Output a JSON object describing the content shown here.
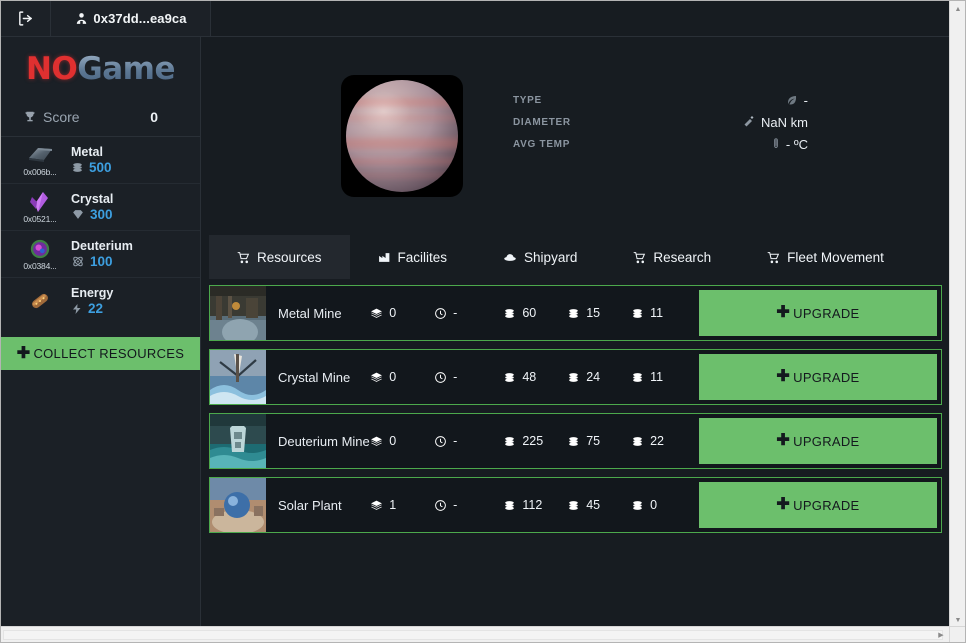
{
  "topbar": {
    "logout_icon": "logout-icon",
    "account_icon": "user-icon",
    "account_label": "0x37dd...ea9ca"
  },
  "sidebar": {
    "logo_primary": "NO",
    "logo_secondary": "Game",
    "score": {
      "icon": "trophy-icon",
      "label": "Score",
      "value": "0"
    },
    "resources": [
      {
        "name": "Metal",
        "address": "0x006b...",
        "amount": "500",
        "icon": "metal-bar-icon",
        "amount_icon": "coins-icon"
      },
      {
        "name": "Crystal",
        "address": "0x0521...",
        "amount": "300",
        "icon": "crystal-icon",
        "amount_icon": "gem-icon"
      },
      {
        "name": "Deuterium",
        "address": "0x0384...",
        "amount": "100",
        "icon": "deuterium-icon",
        "amount_icon": "atom-icon"
      },
      {
        "name": "Energy",
        "address": "",
        "amount": "22",
        "icon": "energy-rod-icon",
        "amount_icon": "bolt-icon"
      }
    ],
    "collect_button": "COLLECT RESOURCES"
  },
  "planet": {
    "image_alt": "planet-thumbnail",
    "stats": [
      {
        "key": "TYPE",
        "icon": "leaf-icon",
        "value": "-"
      },
      {
        "key": "DIAMETER",
        "icon": "ruler-icon",
        "value": "NaN km"
      },
      {
        "key": "AVG TEMP",
        "icon": "thermometer-icon",
        "value": "- ºC"
      }
    ]
  },
  "tabs": [
    {
      "label": "Resources",
      "icon": "cart-icon",
      "active": true
    },
    {
      "label": "Facilites",
      "icon": "factory-icon",
      "active": false
    },
    {
      "label": "Shipyard",
      "icon": "ufo-icon",
      "active": false
    },
    {
      "label": "Research",
      "icon": "cart-icon",
      "active": false
    },
    {
      "label": "Fleet Movement",
      "icon": "cart-icon",
      "active": false
    }
  ],
  "buildings": [
    {
      "name": "Metal Mine",
      "level": "0",
      "time": "-",
      "metal": "60",
      "crystal": "15",
      "deuterium": "11",
      "upgrade_label": "UPGRADE"
    },
    {
      "name": "Crystal Mine",
      "level": "0",
      "time": "-",
      "metal": "48",
      "crystal": "24",
      "deuterium": "11",
      "upgrade_label": "UPGRADE"
    },
    {
      "name": "Deuterium Mine",
      "level": "0",
      "time": "-",
      "metal": "225",
      "crystal": "75",
      "deuterium": "22",
      "upgrade_label": "UPGRADE"
    },
    {
      "name": "Solar Plant",
      "level": "1",
      "time": "-",
      "metal": "112",
      "crystal": "45",
      "deuterium": "0",
      "upgrade_label": "UPGRADE"
    }
  ],
  "colors": {
    "accent_green": "#6cbf6c",
    "border_green": "#4ca94c",
    "amount_blue": "#3d9fe0",
    "logo_red": "#e03030",
    "background": "#171c21",
    "panel": "#1b2026"
  }
}
